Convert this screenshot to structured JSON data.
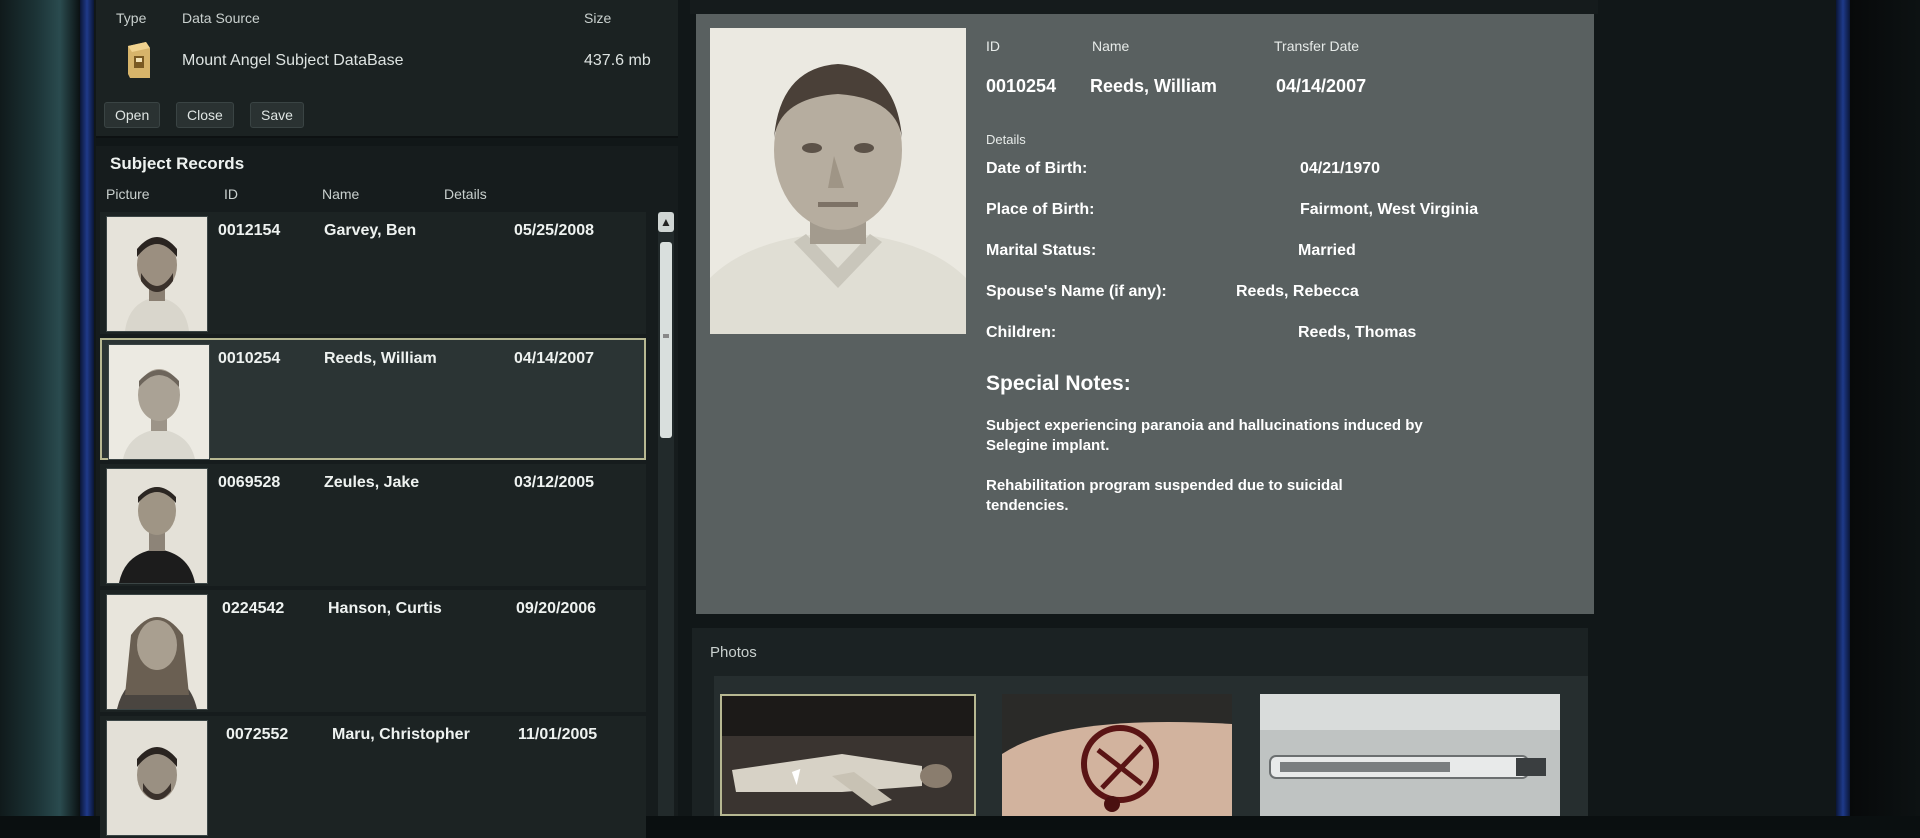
{
  "data_source": {
    "headers": {
      "type": "Type",
      "source": "Data Source",
      "size": "Size"
    },
    "name": "Mount Angel Subject DataBase",
    "size": "437.6 mb",
    "icon": "database-icon",
    "buttons": {
      "open": "Open",
      "close": "Close",
      "save": "Save"
    }
  },
  "subject_records": {
    "title": "Subject Records",
    "columns": {
      "picture": "Picture",
      "id": "ID",
      "name": "Name",
      "details": "Details"
    },
    "rows": [
      {
        "id": "0012154",
        "name": "Garvey, Ben",
        "date": "05/25/2008"
      },
      {
        "id": "0010254",
        "name": "Reeds, William",
        "date": "04/14/2007"
      },
      {
        "id": "0069528",
        "name": "Zeules, Jake",
        "date": "03/12/2005"
      },
      {
        "id": "0224542",
        "name": "Hanson, Curtis",
        "date": "09/20/2006"
      },
      {
        "id": "0072552",
        "name": "Maru, Christopher",
        "date": "11/01/2005"
      }
    ],
    "selected_index": 1
  },
  "detail": {
    "headers": {
      "id": "ID",
      "name": "Name",
      "transfer_date": "Transfer Date"
    },
    "id": "0010254",
    "name": "Reeds, William",
    "transfer_date": "04/14/2007",
    "details_label": "Details",
    "fields": [
      {
        "label": "Date of Birth:",
        "value": "04/21/1970"
      },
      {
        "label": "Place of Birth:",
        "value": "Fairmont, West Virginia"
      },
      {
        "label": "Marital Status:",
        "value": "Married"
      },
      {
        "label": "Spouse's Name (if any):",
        "value": "Reeds, Rebecca"
      },
      {
        "label": "Children:",
        "value": "Reeds, Thomas"
      }
    ],
    "special_notes_title": "Special Notes:",
    "notes": [
      "Subject experiencing paranoia and hallucinations induced by Selegine implant.",
      "Rehabilitation program suspended due to suicidal tendencies."
    ]
  },
  "photos": {
    "title": "Photos",
    "selected_index": 0
  },
  "colors": {
    "panel": "#596060",
    "selection_border": "#b7b892",
    "accent_blue": "#1f3a8a"
  }
}
